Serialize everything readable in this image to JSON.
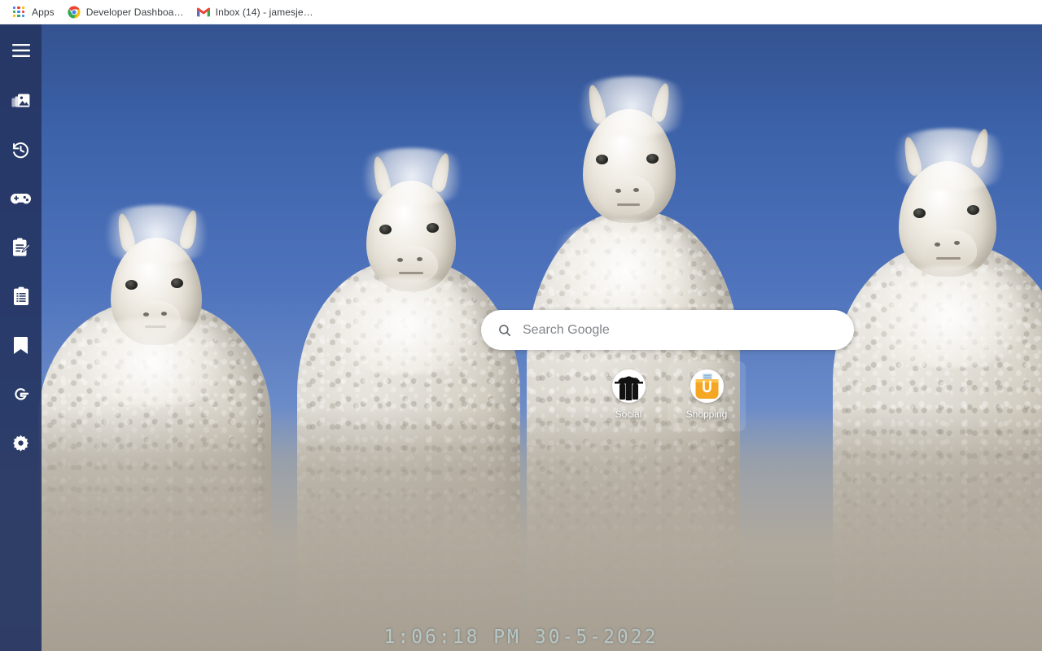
{
  "bookmarks_bar": {
    "items": [
      {
        "label": "Apps",
        "icon": "apps-grid-icon"
      },
      {
        "label": "Developer Dashboa…",
        "icon": "chrome-icon"
      },
      {
        "label": "Inbox (14) - jamesje…",
        "icon": "gmail-icon"
      }
    ]
  },
  "sidebar": {
    "items": [
      {
        "name": "menu",
        "icon": "hamburger-menu-icon"
      },
      {
        "name": "photos",
        "icon": "photos-icon"
      },
      {
        "name": "history",
        "icon": "history-clock-icon"
      },
      {
        "name": "games",
        "icon": "game-controller-icon"
      },
      {
        "name": "notes",
        "icon": "note-pencil-icon"
      },
      {
        "name": "lists",
        "icon": "clipboard-list-icon"
      },
      {
        "name": "bookmarks",
        "icon": "bookmark-icon"
      },
      {
        "name": "google",
        "icon": "google-g-icon"
      },
      {
        "name": "settings",
        "icon": "gear-icon"
      }
    ]
  },
  "search": {
    "placeholder": "Search Google",
    "value": "",
    "icon": "search-icon"
  },
  "shortcuts": {
    "tiles": [
      {
        "label": "Social",
        "icon": "social-people-icon",
        "hovered": false
      },
      {
        "label": "Shopping",
        "icon": "shopping-bag-icon",
        "hovered": true
      }
    ]
  },
  "clock": {
    "text": "1:06:18 PM 30-5-2022"
  },
  "colors": {
    "sidebar": "#263663",
    "sky_top": "#33528f",
    "sky_bottom": "#8aa1c4",
    "tile_label": "#ffffff",
    "clock": "#c4dee0"
  },
  "wallpaper": {
    "description": "Four alpacas against a blue sky"
  }
}
